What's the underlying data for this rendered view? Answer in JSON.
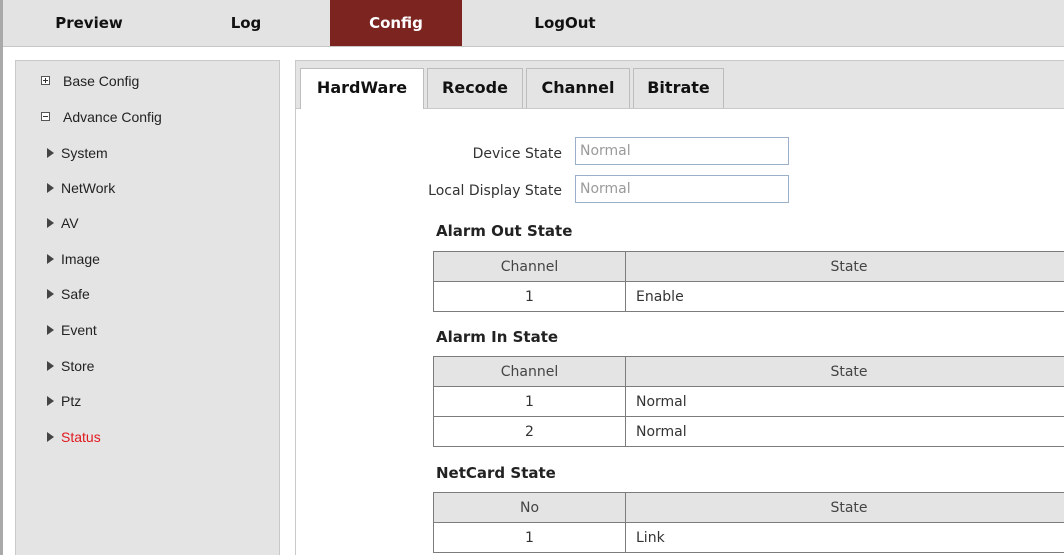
{
  "nav": {
    "items": [
      {
        "label": "Preview"
      },
      {
        "label": "Log"
      },
      {
        "label": "Config"
      },
      {
        "label": "LogOut"
      }
    ],
    "active": "Config"
  },
  "sidebar": {
    "groups": [
      {
        "label": "Base Config",
        "expanded": false
      },
      {
        "label": "Advance Config",
        "expanded": true
      }
    ],
    "items": [
      {
        "label": "System"
      },
      {
        "label": "NetWork"
      },
      {
        "label": "AV"
      },
      {
        "label": "Image"
      },
      {
        "label": "Safe"
      },
      {
        "label": "Event"
      },
      {
        "label": "Store"
      },
      {
        "label": "Ptz"
      },
      {
        "label": "Status"
      }
    ],
    "current": "Status"
  },
  "tabs": [
    {
      "label": "HardWare"
    },
    {
      "label": "Recode"
    },
    {
      "label": "Channel"
    },
    {
      "label": "Bitrate"
    }
  ],
  "active_tab": "HardWare",
  "form": {
    "device_state": {
      "label": "Device State",
      "value": "Normal"
    },
    "local_display_state": {
      "label": "Local Display State",
      "value": "Normal"
    }
  },
  "alarm_out": {
    "title": "Alarm Out State",
    "headers": [
      "Channel",
      "State"
    ],
    "rows": [
      [
        "1",
        "Enable"
      ]
    ]
  },
  "alarm_in": {
    "title": "Alarm In State",
    "headers": [
      "Channel",
      "State"
    ],
    "rows": [
      [
        "1",
        "Normal"
      ],
      [
        "2",
        "Normal"
      ]
    ]
  },
  "netcard": {
    "title": "NetCard State",
    "headers": [
      "No",
      "State"
    ],
    "rows": [
      [
        "1",
        "Link"
      ]
    ]
  },
  "colors": {
    "nav_active_bg": "#7b2420",
    "current_item": "#e0191f",
    "panel_bg": "#e4e4e4"
  }
}
